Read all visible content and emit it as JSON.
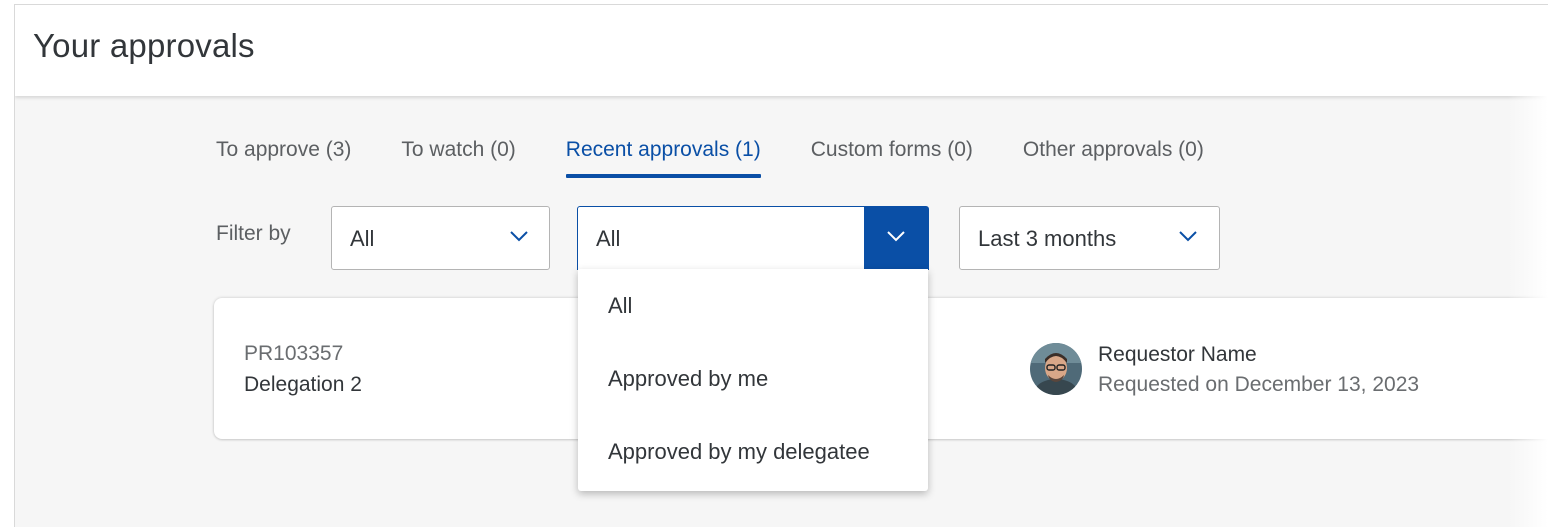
{
  "header": {
    "title": "Your approvals"
  },
  "tabs": [
    {
      "label": "To approve (3)",
      "active": false
    },
    {
      "label": "To watch (0)",
      "active": false
    },
    {
      "label": "Recent approvals (1)",
      "active": true
    },
    {
      "label": "Custom forms (0)",
      "active": false
    },
    {
      "label": "Other approvals (0)",
      "active": false
    }
  ],
  "filters": {
    "label": "Filter by",
    "type": {
      "value": "All"
    },
    "approver": {
      "value": "All",
      "open": true,
      "options": [
        "All",
        "Approved by me",
        "Approved by my delegatee"
      ]
    },
    "period": {
      "value": "Last 3 months"
    }
  },
  "card": {
    "id": "PR103357",
    "title": "Delegation 2",
    "requestor_name": "Requestor Name",
    "requested_on": "Requested on December 13, 2023"
  },
  "colors": {
    "accent": "#0a4fa6",
    "text": "#32363a",
    "muted": "#6a6d70",
    "background": "#f6f6f6"
  },
  "icons": {
    "dropdown": "chevron-down-icon",
    "avatar": "user-avatar-photo"
  }
}
